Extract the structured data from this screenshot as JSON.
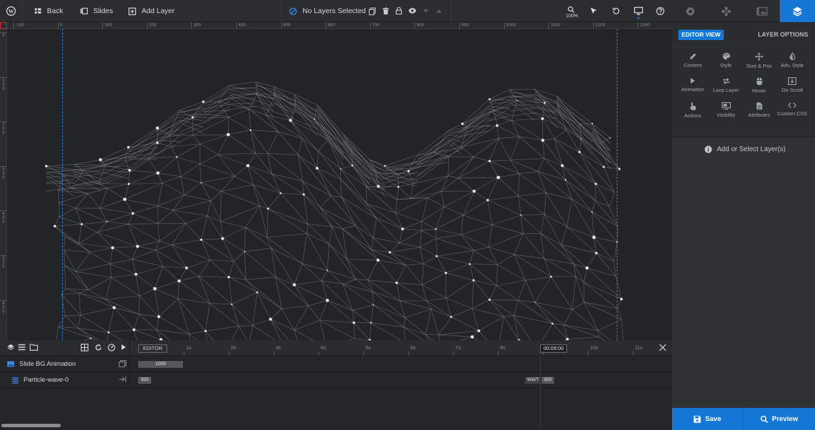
{
  "topbar": {
    "back_label": "Back",
    "slides_label": "Slides",
    "add_layer_label": "Add Layer",
    "status_label": "No Layers Selected",
    "zoom_label": "100%"
  },
  "ruler": {
    "h_labels": [
      "-100",
      "0",
      "100",
      "200",
      "300",
      "400",
      "500",
      "600",
      "700",
      "800",
      "900",
      "1000",
      "1100",
      "1200",
      "1300"
    ],
    "v_labels": [
      "0",
      "100",
      "200",
      "300",
      "400",
      "500",
      "600"
    ]
  },
  "right_panel": {
    "editor_view_label": "EDITOR VIEW",
    "layer_options_label": "LAYER OPTIONS",
    "options": [
      {
        "label": "Content",
        "icon": "pencil-icon"
      },
      {
        "label": "Style",
        "icon": "palette-icon"
      },
      {
        "label": "Size & Pos",
        "icon": "move-icon"
      },
      {
        "label": "Adv. Style",
        "icon": "drop-icon"
      },
      {
        "label": "Animation",
        "icon": "play-icon"
      },
      {
        "label": "Loop Layer",
        "icon": "loop-icon"
      },
      {
        "label": "Hover",
        "icon": "mouse-icon"
      },
      {
        "label": "On Scroll",
        "icon": "scroll-icon"
      },
      {
        "label": "Actions",
        "icon": "hand-pointer-icon"
      },
      {
        "label": "Visibility",
        "icon": "monitor-icon"
      },
      {
        "label": "Attributes",
        "icon": "document-icon"
      },
      {
        "label": "Custom CSS",
        "icon": "code-icon"
      }
    ],
    "hint_text": "Add or Select Layer(s)"
  },
  "actions": {
    "save_label": "Save",
    "preview_label": "Preview"
  },
  "timeline": {
    "editor_label": "EDITOR",
    "seconds": [
      "1s",
      "2s",
      "3s",
      "4s",
      "5s",
      "6s",
      "7s",
      "8s",
      "9s",
      "10s",
      "11s"
    ],
    "current_time": "00:09:00",
    "rows": [
      {
        "label": "Slide BG Animation",
        "bar_value": "1000"
      },
      {
        "label": "Particle-wave-0",
        "bar_value": "300",
        "wait_label": "WAIT",
        "wait_value": "300"
      }
    ]
  },
  "colors": {
    "accent": "#1477d6",
    "guide": "#2f7fd6",
    "ruler_origin": "#cf2e3a"
  }
}
